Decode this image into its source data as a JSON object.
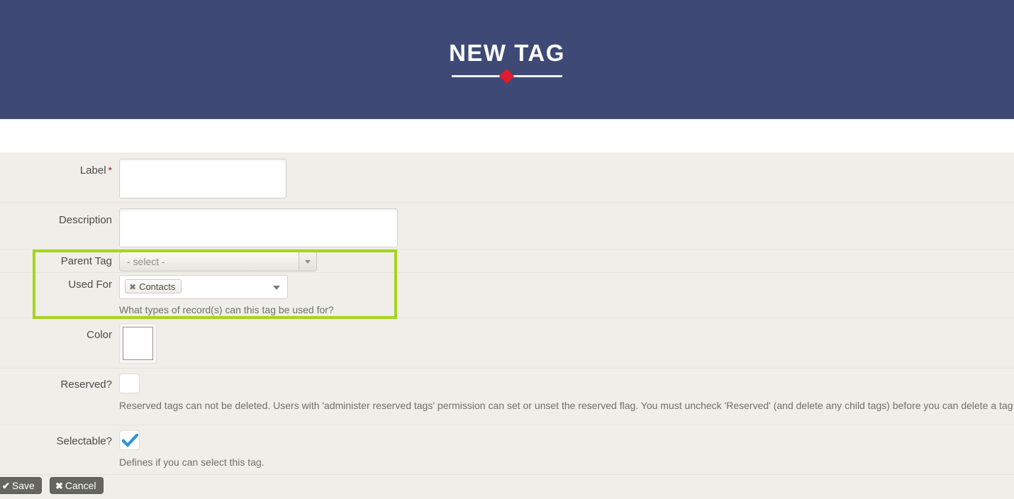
{
  "header": {
    "title": "NEW TAG",
    "background_color": "#3e4a75",
    "diamond_color": "#e01b2e",
    "rule_color": "#f2f2f4"
  },
  "highlight": {
    "color": "#a6d420",
    "covers": [
      "Parent Tag",
      "Used For"
    ]
  },
  "form": {
    "background_color": "#efeee8",
    "fields": [
      {
        "label": "Label",
        "required_marker": "*",
        "type": "text",
        "value": "",
        "placeholder": ""
      },
      {
        "label": "Description",
        "type": "textarea",
        "value": "",
        "placeholder": ""
      },
      {
        "label": "Parent Tag",
        "type": "select",
        "selected": "- select -",
        "caret_icon": "chevron-down-icon"
      },
      {
        "label": "Used For",
        "type": "multiselect",
        "chips": [
          {
            "text": "Contacts",
            "remove_icon": "close-icon"
          }
        ],
        "caret_icon": "chevron-down-icon",
        "help": "What types of record(s) can this tag be used for?"
      },
      {
        "label": "Color",
        "type": "color",
        "value": "#ffffff"
      },
      {
        "label": "Reserved?",
        "type": "checkbox",
        "checked": false,
        "help": "Reserved tags can not be deleted. Users with 'administer reserved tags' permission can set or unset the reserved flag. You must uncheck 'Reserved' (and delete any child tags) before you can delete a tag."
      },
      {
        "label": "Selectable?",
        "type": "checkbox",
        "checked": true,
        "checkmark_color": "#2d93d6",
        "help": "Defines if you can select this tag."
      }
    ]
  },
  "buttons": {
    "save": {
      "label": "Save",
      "icon": "check-icon",
      "glyph": "✔"
    },
    "cancel": {
      "label": "Cancel",
      "icon": "close-icon",
      "glyph": "✖"
    }
  }
}
